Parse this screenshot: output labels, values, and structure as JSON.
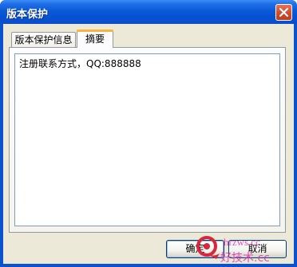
{
  "window": {
    "title": "版本保护",
    "close_icon": "close-icon"
  },
  "tabs": [
    {
      "label": "版本保护信息",
      "selected": false
    },
    {
      "label": "摘要",
      "selected": true
    }
  ],
  "summary": {
    "text": "注册联系方式，QQ:888888"
  },
  "buttons": {
    "ok_label": "确定",
    "cancel_label": "取消"
  },
  "watermark": {
    "line1": "hrzws.cc",
    "line2": "好技术.cc",
    "color": "#e22fb3"
  }
}
